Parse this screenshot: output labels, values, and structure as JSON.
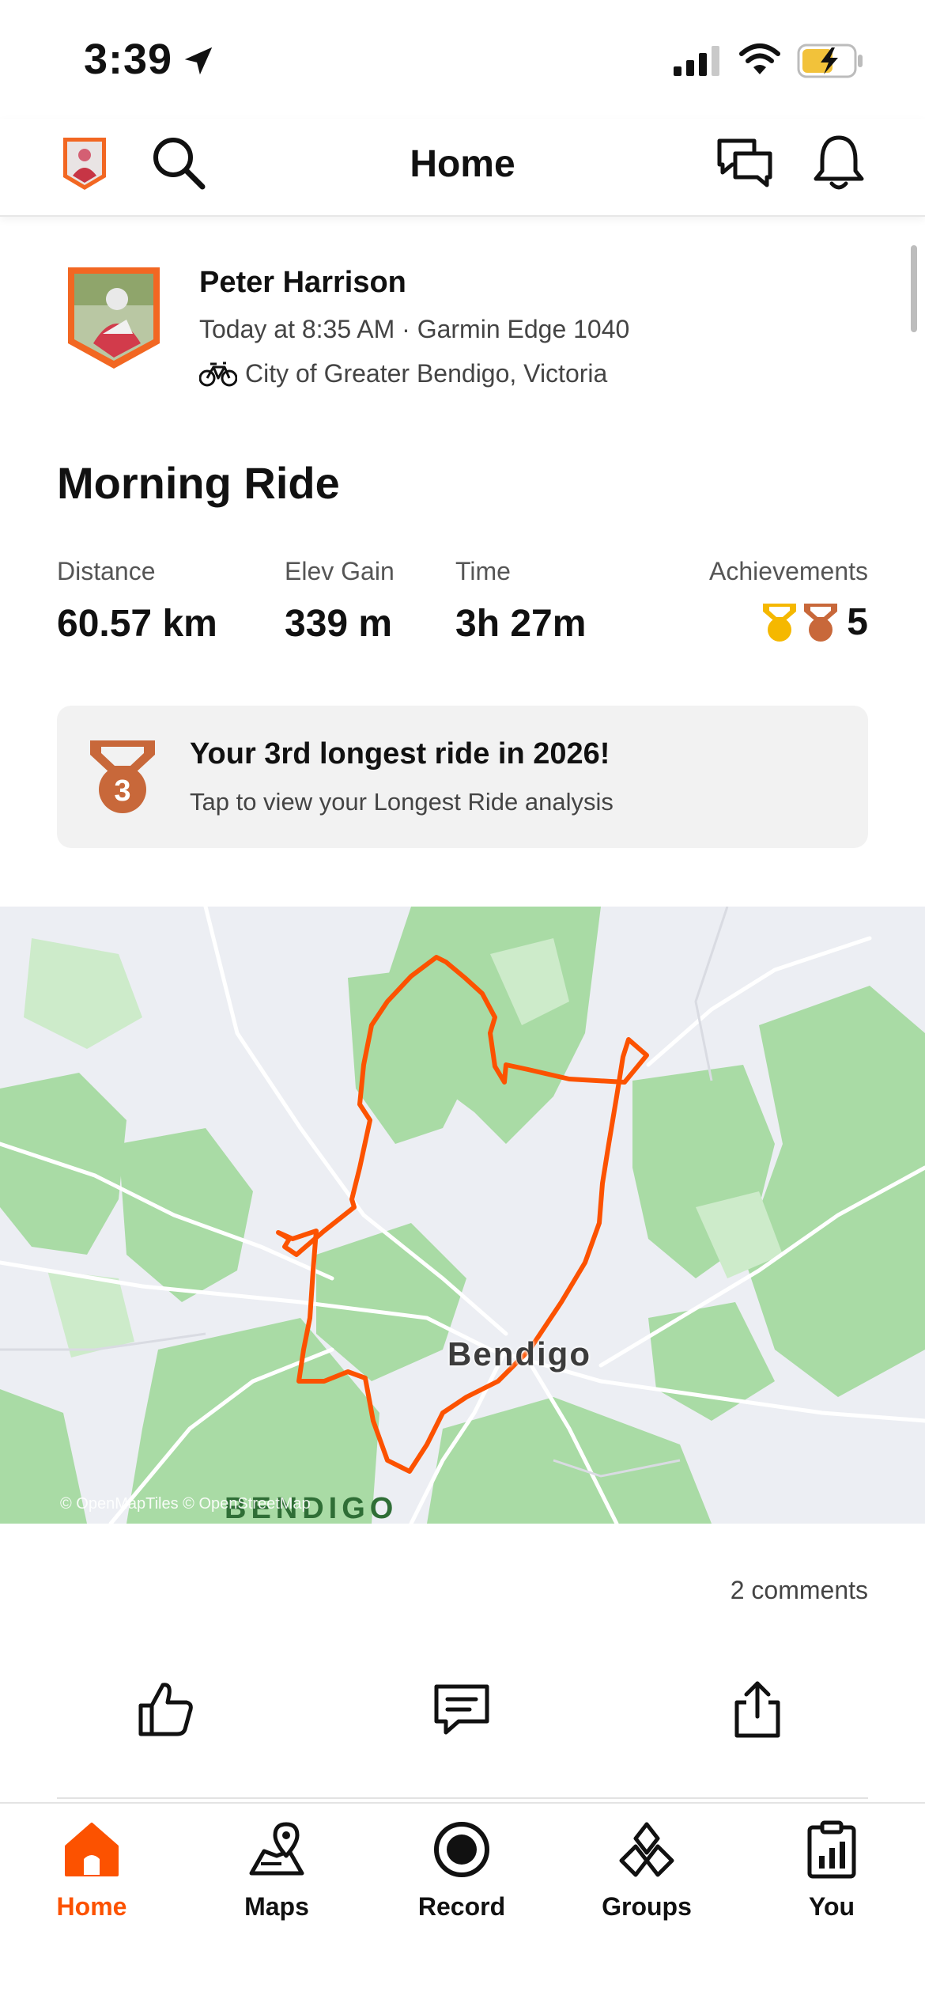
{
  "status_bar": {
    "time": "3:39"
  },
  "header": {
    "title": "Home"
  },
  "activity": {
    "athlete_name": "Peter Harrison",
    "meta": "Today at 8:35 AM · Garmin Edge 1040",
    "location": "City of Greater Bendigo, Victoria",
    "title": "Morning Ride",
    "stats": [
      {
        "label": "Distance",
        "value": "60.57 km"
      },
      {
        "label": "Elev Gain",
        "value": "339 m"
      },
      {
        "label": "Time",
        "value": "3h 27m"
      }
    ],
    "achievements": {
      "label": "Achievements",
      "count": "5"
    }
  },
  "highlight": {
    "badge_number": "3",
    "title": "Your 3rd longest ride in 2026!",
    "subtitle": "Tap to view your Longest Ride analysis"
  },
  "map": {
    "city_label": "Bendigo",
    "region_label": "BENDIGO",
    "attribution": "© OpenMapTiles © OpenStreetMap",
    "route_color": "#fc5200"
  },
  "comments": {
    "count_label": "2 comments"
  },
  "tabs": [
    {
      "label": "Home",
      "icon": "home-icon",
      "active": true
    },
    {
      "label": "Maps",
      "icon": "map-icon",
      "active": false
    },
    {
      "label": "Record",
      "icon": "record-icon",
      "active": false
    },
    {
      "label": "Groups",
      "icon": "groups-icon",
      "active": false
    },
    {
      "label": "You",
      "icon": "clipboard-chart-icon",
      "active": false
    }
  ],
  "colors": {
    "brand": "#fc5200",
    "map_green": "#a8dca4",
    "map_bg": "#eceef3"
  }
}
